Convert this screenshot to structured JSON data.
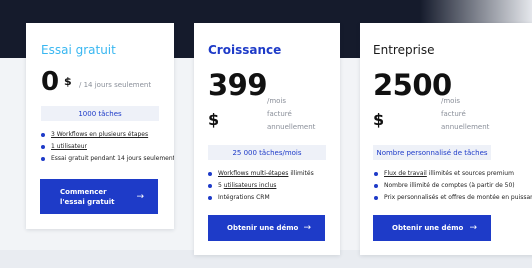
{
  "colors": {
    "accent": "#1e3bc8",
    "free_plan": "#39b7f1",
    "band": "#151b2c"
  },
  "plans": [
    {
      "name": "Essai gratuit",
      "price": "0",
      "currency": "$",
      "price_note": "/ 14 jours seulement",
      "quota": "1000 tâches",
      "features": [
        {
          "parts": [
            {
              "text": "3 Workflows en plusieurs étapes",
              "underline": true
            }
          ]
        },
        {
          "parts": [
            {
              "text": "1 utilisateur",
              "underline": true
            }
          ]
        },
        {
          "parts": [
            {
              "text": "Essai gratuit pendant 14 jours seulement",
              "underline": false
            }
          ]
        }
      ],
      "cta": "Commencer l'essai gratuit",
      "cta_icon": "arrow-right-icon"
    },
    {
      "name": "Croissance",
      "price": "399",
      "currency": "$",
      "period_lines": [
        "/mois",
        "facturé",
        "annuellement"
      ],
      "quota": "25 000 tâches/mois",
      "features": [
        {
          "parts": [
            {
              "text": "Workflows multi-étapes",
              "underline": true
            },
            {
              "text": " illimités",
              "underline": false
            }
          ]
        },
        {
          "parts": [
            {
              "text": "5 ",
              "underline": false
            },
            {
              "text": "utilisateurs inclus",
              "underline": true
            }
          ]
        },
        {
          "parts": [
            {
              "text": "Intégrations CRM",
              "underline": false
            }
          ]
        }
      ],
      "cta": "Obtenir une démo",
      "cta_icon": "arrow-right-icon"
    },
    {
      "name": "Entreprise",
      "price": "2500",
      "currency": "$",
      "period_lines": [
        "/mois",
        "facturé",
        "annuellement"
      ],
      "quota": "Nombre personnalisé de tâches",
      "features": [
        {
          "parts": [
            {
              "text": "Flux de travail",
              "underline": true
            },
            {
              "text": " illimités et sources premium",
              "underline": false
            }
          ]
        },
        {
          "parts": [
            {
              "text": "Nombre illimité de comptes (à partir de 50)",
              "underline": false
            }
          ]
        },
        {
          "parts": [
            {
              "text": "Prix personnalisés et offres de montée en puissance",
              "underline": false
            }
          ]
        }
      ],
      "cta": "Obtenir une démo",
      "cta_icon": "arrow-right-icon"
    }
  ]
}
